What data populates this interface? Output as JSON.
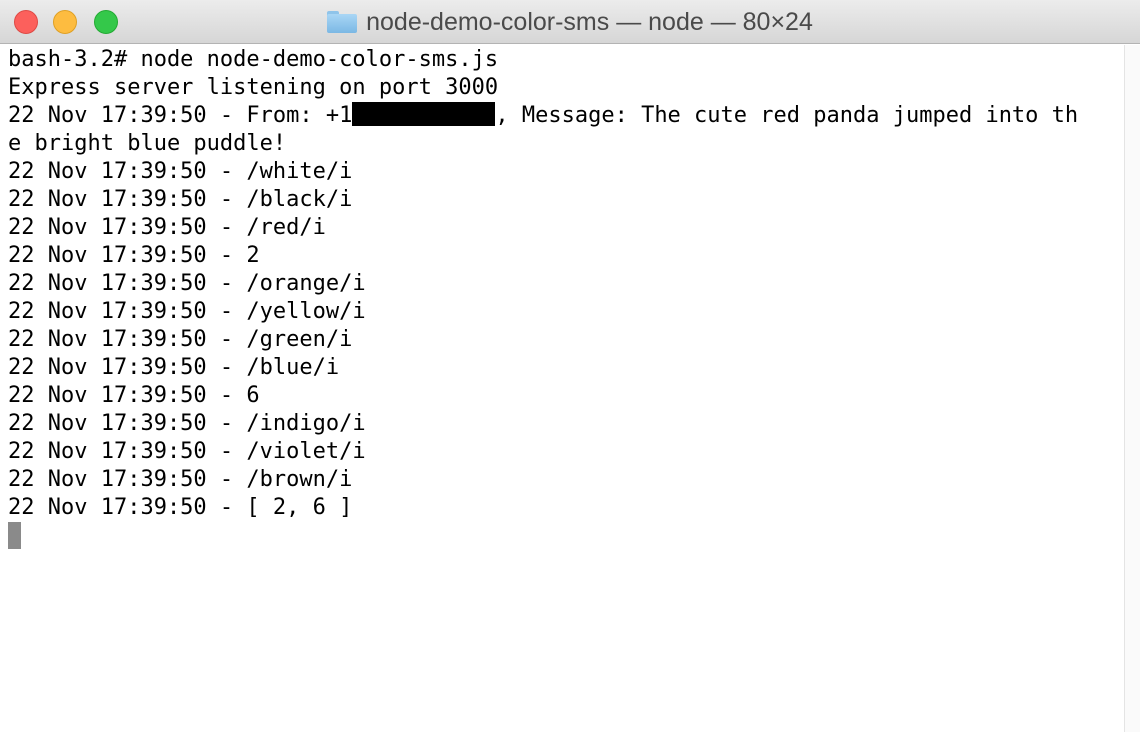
{
  "window": {
    "title": "node-demo-color-sms — node — 80×24",
    "folder_icon": "folder-icon",
    "traffic_lights": {
      "close": "#fc605c",
      "minimize": "#fdbc40",
      "zoom": "#34c84a"
    }
  },
  "terminal": {
    "lines": [
      "bash-3.2# node node-demo-color-sms.js",
      "Express server listening on port 3000"
    ],
    "from_line": {
      "prefix": "22 Nov 17:39:50 - From: +1",
      "suffix": ", Message: The cute red panda jumped into th"
    },
    "lines_after": [
      "e bright blue puddle!",
      "22 Nov 17:39:50 - /white/i",
      "22 Nov 17:39:50 - /black/i",
      "22 Nov 17:39:50 - /red/i",
      "22 Nov 17:39:50 - 2",
      "22 Nov 17:39:50 - /orange/i",
      "22 Nov 17:39:50 - /yellow/i",
      "22 Nov 17:39:50 - /green/i",
      "22 Nov 17:39:50 - /blue/i",
      "22 Nov 17:39:50 - 6",
      "22 Nov 17:39:50 - /indigo/i",
      "22 Nov 17:39:50 - /violet/i",
      "22 Nov 17:39:50 - /brown/i",
      "22 Nov 17:39:50 - [ 2, 6 ]"
    ]
  }
}
